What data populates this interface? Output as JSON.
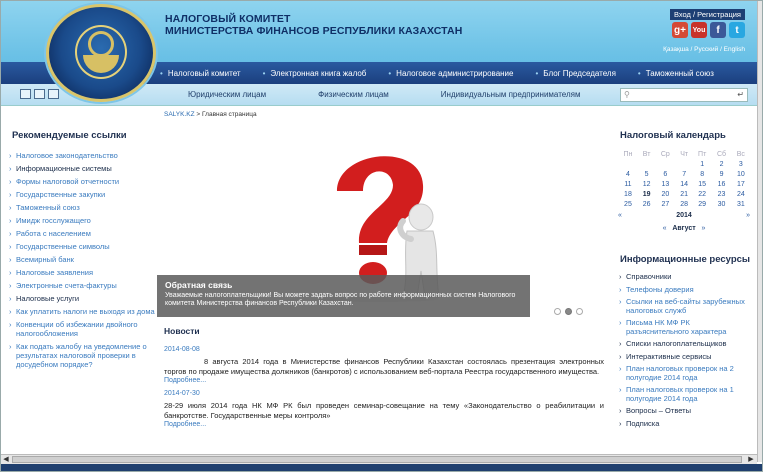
{
  "header": {
    "title_line1": "НАЛОГОВЫЙ КОМИТЕТ",
    "title_line2": "МИНИСТЕРСТВА ФИНАНСОВ РЕСПУБЛИКИ КАЗАХСТАН",
    "auth": "Вход / Регистрация",
    "languages": "Қазақша / Русский / English",
    "social_icons": [
      "google-plus-icon",
      "youtube-icon",
      "facebook-icon",
      "twitter-icon"
    ]
  },
  "topnav": [
    "Налоговый комитет",
    "Электронная книга жалоб",
    "Налоговое администрирование",
    "Блог Председателя",
    "Таможенный союз"
  ],
  "subnav": {
    "audiences": [
      "Юридическим лицам",
      "Физическим лицам",
      "Индивидуальным предпринимателям"
    ],
    "search_placeholder": ""
  },
  "breadcrumb": {
    "root": "SALYK.KZ",
    "sep": " > ",
    "current": "Главная страница"
  },
  "left": {
    "title": "Рекомендуемые ссылки",
    "links": [
      "Налоговое законодательство",
      "Информационные системы",
      "Формы налоговой отчетности",
      "Государственные закупки",
      "Таможенный союз",
      "Имидж госслужащего",
      "Работа с населением",
      "Государственные символы",
      "Всемирный банк",
      "Налоговые заявления",
      "Электронные счета-фактуры",
      "Налоговые услуги",
      "Как уплатить налоги не выходя из дома",
      "Конвенции об избежании двойного налогообложения",
      "Как подать жалобу на уведомление о результатах налоговой проверки в досудебном порядке?"
    ]
  },
  "slider": {
    "caption_title": "Обратная связь",
    "caption_text": "Уважаемые налогоплательщики! Вы можете задать вопрос по работе информационных систем Налогового комитета Министерства финансов Республики Казахстан.",
    "dots": 3,
    "active_dot": 2
  },
  "news": {
    "title": "Новости",
    "items": [
      {
        "date": "2014-08-08",
        "text": "8 августа 2014 года в Министерстве финансов Республики Казахстан состоялась презентация электронных торгов по продаже имущества должников (банкротов) с использованием веб-портала Реестра государственного имущества.",
        "more": "Подробнее..."
      },
      {
        "date": "2014-07-30",
        "text": "28-29 июля 2014 года НК МФ РК был проведен семинар-совещание на тему «Законодательство о реабилитации и банкротстве. Государственные меры контроля»",
        "more": "Подробнее..."
      }
    ]
  },
  "calendar": {
    "title": "Налоговый календарь",
    "weekdays": [
      "Пн",
      "Вт",
      "Ср",
      "Чт",
      "Пт",
      "Сб",
      "Вс"
    ],
    "rows": [
      [
        "",
        "",
        "",
        "",
        "1",
        "2",
        "3"
      ],
      [
        "4",
        "5",
        "6",
        "7",
        "8",
        "9",
        "10"
      ],
      [
        "11",
        "12",
        "13",
        "14",
        "15",
        "16",
        "17"
      ],
      [
        "18",
        "19",
        "20",
        "21",
        "22",
        "23",
        "24"
      ],
      [
        "25",
        "26",
        "27",
        "28",
        "29",
        "30",
        "31"
      ]
    ],
    "prev": "«",
    "year": "2014",
    "next": "»",
    "month": "Август"
  },
  "resources": {
    "title": "Информационные ресурсы",
    "links": [
      "Справочники",
      "Телефоны доверия",
      "Ссылки на веб-сайты зарубежных налоговых служб",
      "Письма НК МФ РК разъяснительного характера",
      "Списки налогоплательщиков",
      "Интерактивные сервисы",
      "План налоговых проверок на 2 полугодие 2014 года",
      "План налоговых проверок на 1 полугодие 2014 года",
      "Вопросы – Ответы",
      "Подписка"
    ]
  }
}
